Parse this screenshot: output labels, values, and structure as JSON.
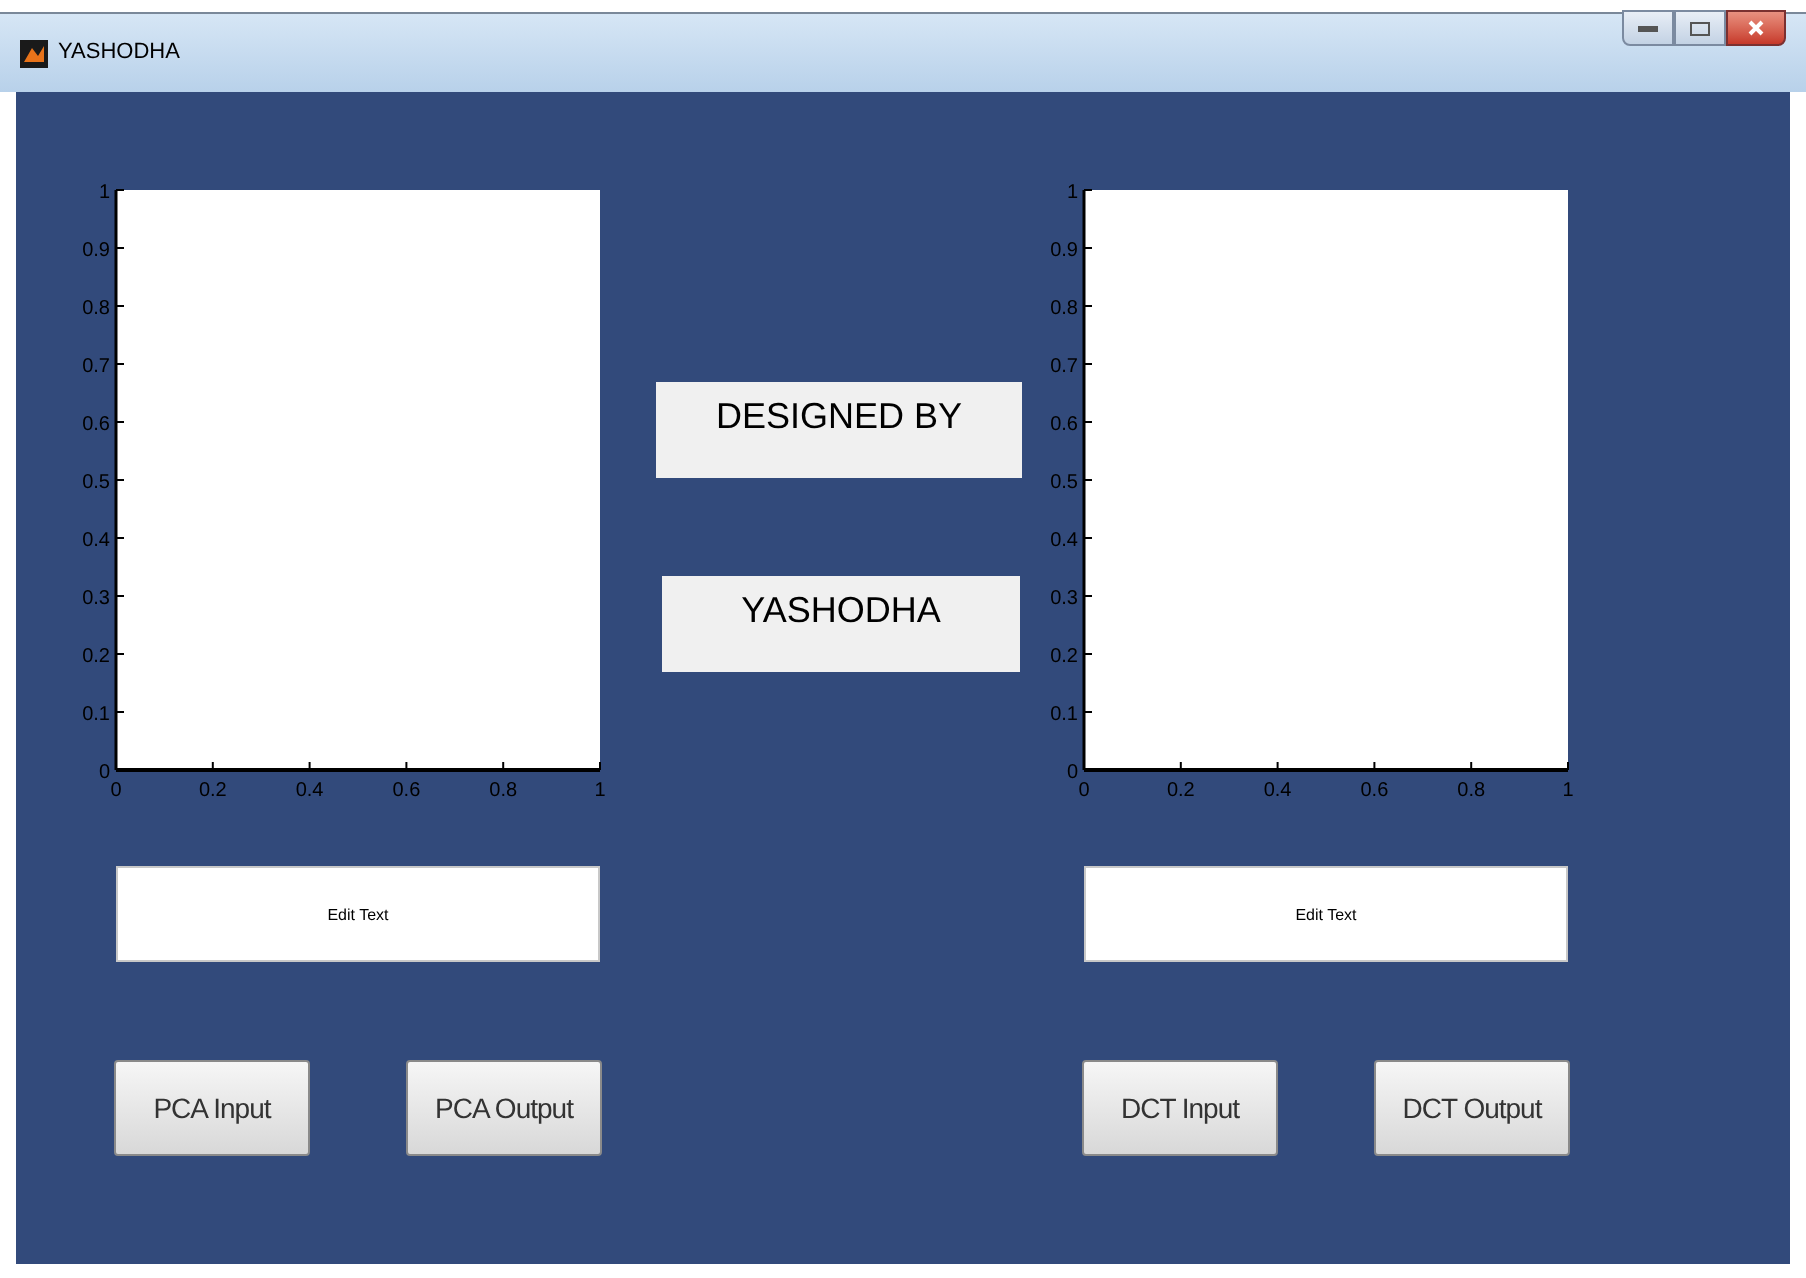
{
  "window": {
    "title": "YASHODHA"
  },
  "panels": [
    {
      "axes": {
        "chart_data": {
          "type": "line",
          "xlim": [
            0,
            1
          ],
          "ylim": [
            0,
            1
          ],
          "xticks": [
            0,
            0.2,
            0.4,
            0.6,
            0.8,
            1
          ],
          "yticks": [
            0,
            0.1,
            0.2,
            0.3,
            0.4,
            0.5,
            0.6,
            0.7,
            0.8,
            0.9,
            1
          ]
        }
      },
      "edit_text": {
        "value": "Edit Text"
      },
      "buttons": [
        "PCA Input",
        "PCA Output"
      ]
    },
    {
      "axes": {
        "chart_data": {
          "type": "line",
          "xlim": [
            0,
            1
          ],
          "ylim": [
            0,
            1
          ],
          "xticks": [
            0,
            0.2,
            0.4,
            0.6,
            0.8,
            1
          ],
          "yticks": [
            0,
            0.1,
            0.2,
            0.3,
            0.4,
            0.5,
            0.6,
            0.7,
            0.8,
            0.9,
            1
          ]
        }
      },
      "edit_text": {
        "value": "Edit Text"
      },
      "buttons": [
        "DCT Input",
        "DCT Output"
      ]
    }
  ],
  "static_texts": [
    "DESIGNED BY",
    "YASHODHA"
  ]
}
